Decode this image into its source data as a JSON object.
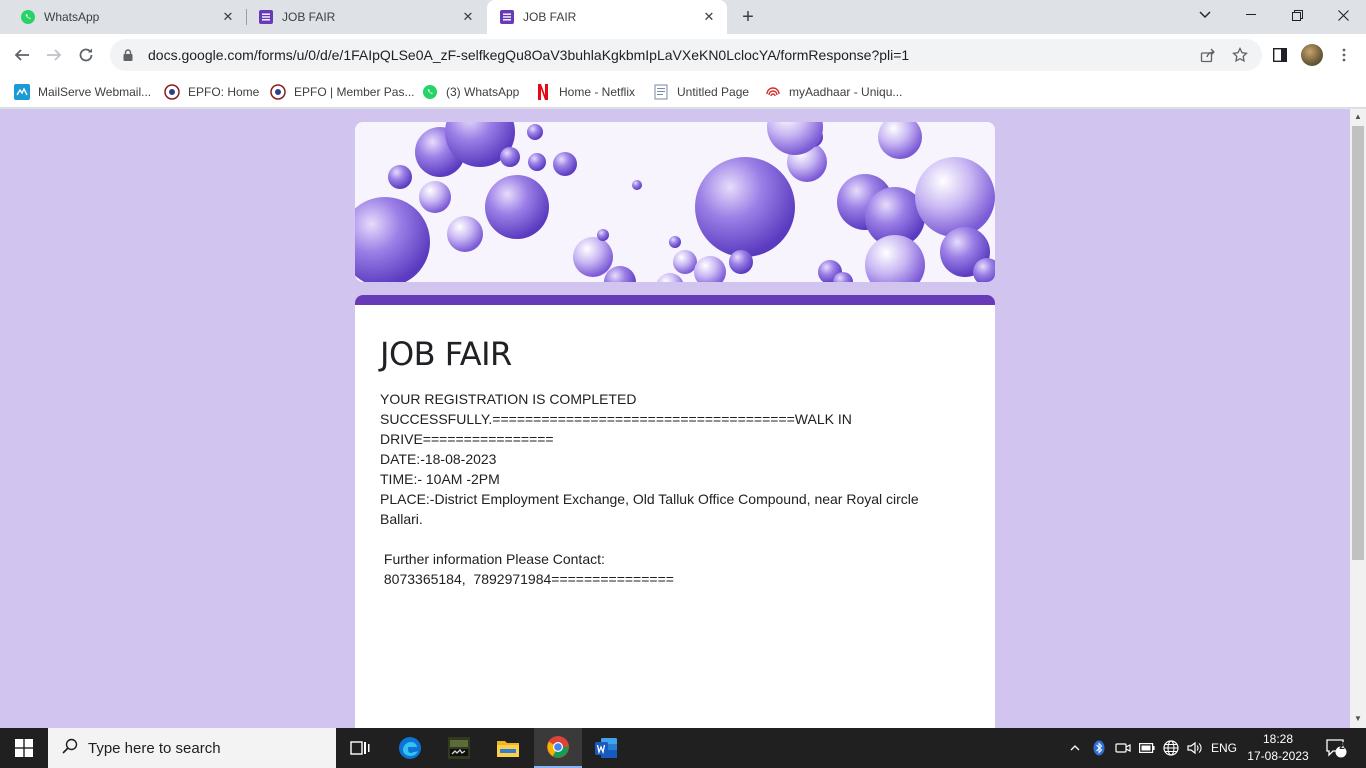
{
  "browser": {
    "tabs": [
      {
        "label": "WhatsApp",
        "icon": "whatsapp-icon"
      },
      {
        "label": "JOB FAIR",
        "icon": "google-forms-icon"
      },
      {
        "label": "JOB FAIR",
        "icon": "google-forms-icon",
        "active": true
      }
    ],
    "url": "docs.google.com/forms/u/0/d/e/1FAIpQLSe0A_zF-selfkegQu8OaV3buhlaKgkbmIpLaVXeKN0LclocYA/formResponse?pli=1",
    "bookmarks": [
      {
        "label": "MailServe Webmail...",
        "icon": "mailserve-icon"
      },
      {
        "label": "EPFO: Home",
        "icon": "epfo-icon"
      },
      {
        "label": "EPFO | Member Pas...",
        "icon": "epfo-icon"
      },
      {
        "label": "(3) WhatsApp",
        "icon": "whatsapp-icon"
      },
      {
        "label": "Home - Netflix",
        "icon": "netflix-icon"
      },
      {
        "label": "Untitled Page",
        "icon": "page-icon"
      },
      {
        "label": "myAadhaar - Uniqu...",
        "icon": "aadhaar-icon"
      }
    ]
  },
  "form": {
    "title": "JOB FAIR",
    "lines": [
      "YOUR REGISTRATION IS COMPLETED",
      "SUCCESSFULLY.=====================================WALK IN",
      "DRIVE================",
      "DATE:-18-08-2023",
      "TIME:- 10AM -2PM",
      "PLACE:-District Employment Exchange, Old Talluk Office Compound, near Royal circle",
      "Ballari.",
      "",
      " Further information Please Contact:",
      " 8073365184,  7892971984==============="
    ]
  },
  "taskbar": {
    "search_placeholder": "Type here to search",
    "language": "ENG",
    "time": "18:28",
    "date": "17-08-2023",
    "notification_count": "2"
  },
  "colors": {
    "page_bg": "#d1c4ee",
    "accent": "#673ab7"
  }
}
